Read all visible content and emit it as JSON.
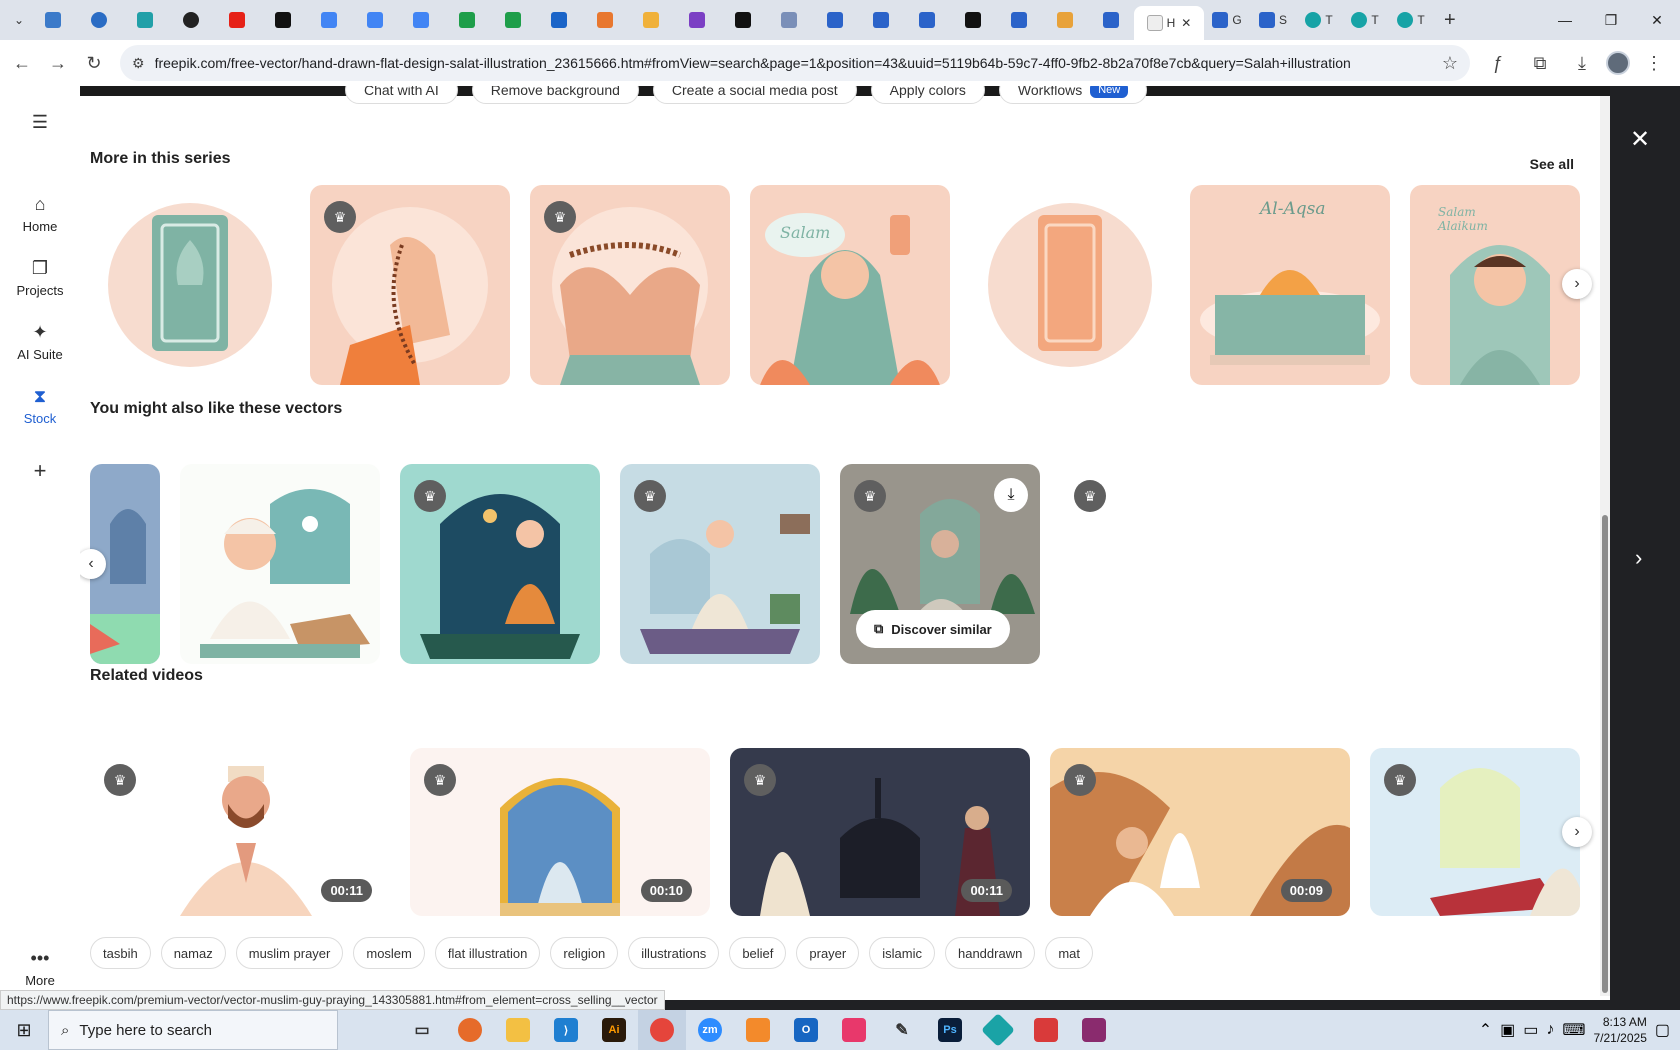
{
  "browser": {
    "active_tab_title": "H",
    "tab_titles": [
      "G",
      "S",
      "T",
      "T",
      "T"
    ],
    "url": "freepik.com/free-vector/hand-drawn-flat-design-salat-illustration_23615666.htm#fromView=search&page=1&position=43&uuid=5119b64b-59c7-4ff0-9fb2-8b2a70f8e7cb&query=Salah+illustration",
    "status_url": "https://www.freepik.com/premium-vector/vector-muslim-guy-praying_143305881.htm#from_element=cross_selling__vector"
  },
  "sidebar": {
    "items": [
      {
        "label": "Home",
        "icon": "home-icon"
      },
      {
        "label": "Projects",
        "icon": "projects-icon"
      },
      {
        "label": "AI Suite",
        "icon": "sparkle-icon"
      },
      {
        "label": "Stock",
        "icon": "stock-icon"
      }
    ],
    "more_label": "More"
  },
  "toolbar_pills": [
    "Chat with AI",
    "Remove background",
    "Create a social media post",
    "Apply colors",
    "Workflows"
  ],
  "new_badge": "New",
  "series": {
    "title": "More in this series",
    "see_all": "See all",
    "items": [
      {
        "text": "",
        "bg": "#f7dccf"
      },
      {
        "text": "",
        "bg": "#f7d3c2"
      },
      {
        "text": "",
        "bg": "#f7d3c2"
      },
      {
        "text": "Salam",
        "bg": "#f7d3c2"
      },
      {
        "text": "",
        "bg": "#f7dccf"
      },
      {
        "text": "Al-Aqsa",
        "bg": "#f7d3c2"
      },
      {
        "text": "Salam Alaikum",
        "bg": "#f7d3c2"
      }
    ]
  },
  "similar": {
    "title": "You might also like these vectors",
    "discover_label": "Discover similar"
  },
  "videos": {
    "title": "Related videos",
    "durations": [
      "00:11",
      "00:10",
      "00:11",
      "00:09"
    ]
  },
  "tags": [
    "tasbih",
    "namaz",
    "muslim prayer",
    "moslem",
    "flat illustration",
    "religion",
    "illustrations",
    "belief",
    "prayer",
    "islamic",
    "handdrawn",
    "mat"
  ],
  "taskbar": {
    "search_placeholder": "Type here to search",
    "time": "8:13 AM",
    "date": "7/21/2025"
  }
}
